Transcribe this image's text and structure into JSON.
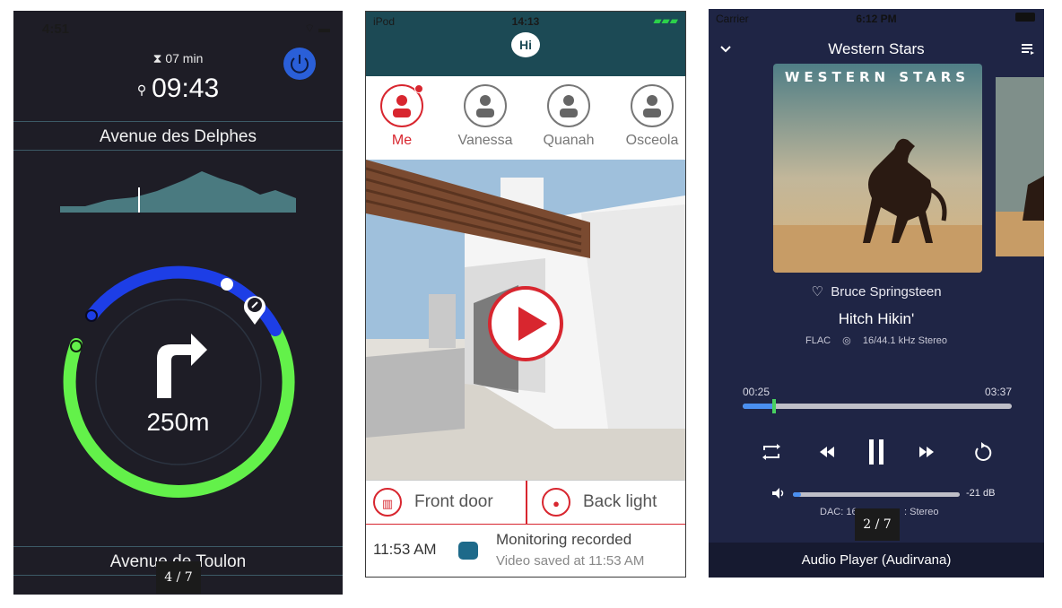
{
  "nav": {
    "status_time": "4:51",
    "eta": "07 min",
    "clock": "09:43",
    "street_current": "Avenue des Delphes",
    "distance": "250m",
    "street_next": "Avenue de Toulon",
    "pager": "4 / 7"
  },
  "hi_app": {
    "status_carrier": "iPod",
    "status_time": "14:13",
    "logo": "Hi",
    "contacts": [
      {
        "name": "Me",
        "active": true
      },
      {
        "name": "Vanessa",
        "active": false
      },
      {
        "name": "Quanah",
        "active": false
      },
      {
        "name": "Osceola",
        "active": false
      }
    ],
    "devices": [
      {
        "label": "Front door",
        "icon": "gate-icon"
      },
      {
        "label": "Back light",
        "icon": "bulb-icon"
      }
    ],
    "event": {
      "time": "11:53 AM",
      "title": "Monitoring recorded",
      "subtitle": "Video saved at 11:53 AM"
    }
  },
  "player": {
    "status_carrier": "Carrier",
    "status_time": "6:12 PM",
    "album_title": "Western Stars",
    "cover_text": "WESTERN STARS",
    "artist": "Bruce Springsteen",
    "track": "Hitch Hikin'",
    "format": "FLAC",
    "quality": "16/44.1 kHz Stereo",
    "elapsed": "00:25",
    "total": "03:37",
    "progress": 0.115,
    "volume_db": "-21 dB",
    "volume_level": 0.05,
    "dac_left": "DAC: 16",
    "dac_right": ": Stereo",
    "footer": "Audio Player (Audirvana)",
    "pager": "2 / 7"
  },
  "colors": {
    "nav_bg": "#1e1d26",
    "nav_blue": "#1d3ee6",
    "nav_green": "#63f14a",
    "hi_red": "#d8262f",
    "hi_teal": "#1c4a55",
    "player_bg": "#1f2545",
    "player_accent": "#4a8ff0"
  }
}
